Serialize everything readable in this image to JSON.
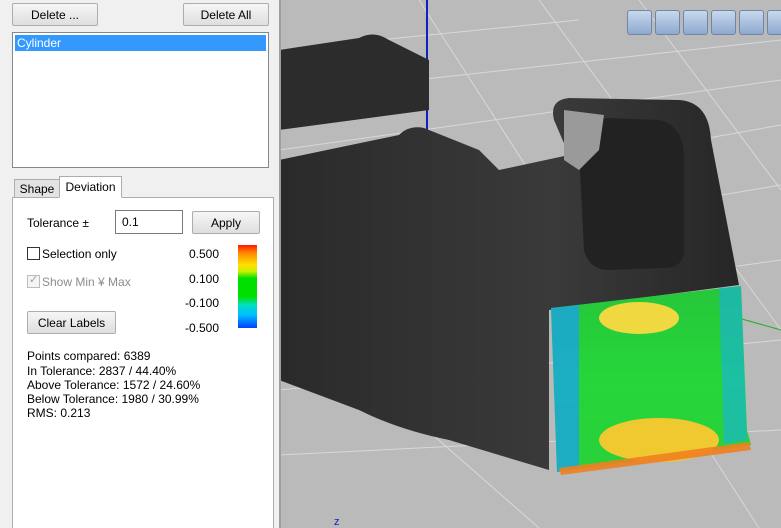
{
  "toolbar": {
    "delete_label": "Delete ...",
    "delete_all_label": "Delete All"
  },
  "objects": {
    "items": [
      "Cylinder"
    ],
    "selected": 0
  },
  "tabs": [
    {
      "label": "Shape",
      "active": false
    },
    {
      "label": "Deviation",
      "active": true
    }
  ],
  "deviation": {
    "tolerance_label": "Tolerance ±",
    "tolerance_value": "0.1",
    "apply_label": "Apply",
    "selection_only_label": "Selection only",
    "selection_only_checked": false,
    "show_minmax_label": "Show Min ¥ Max",
    "show_minmax_checked": true,
    "show_minmax_enabled": false,
    "clear_labels_label": "Clear Labels",
    "scale": {
      "labels": [
        "0.500",
        "0.100",
        "-0.100",
        "-0.500"
      ],
      "colors": [
        "#ff1a00",
        "#ff8c00",
        "#ffe000",
        "#00e000",
        "#00c0ff",
        "#0040ff"
      ]
    },
    "stats": {
      "points": "Points compared: 6389",
      "in_tol": "In Tolerance: 2837 / 44.40%",
      "above_tol": "Above Tolerance: 1572 / 24.60%",
      "below_tol": "Below Tolerance: 1980 / 30.99%",
      "rms": "RMS: 0.213"
    }
  },
  "viewport": {
    "background": "#bababa",
    "tools": [
      "zoom-fit-icon",
      "zoom-icon",
      "rotate-icon",
      "pan-icon",
      "zoom-plus-icon",
      "more-icon"
    ],
    "axis_label": "z"
  }
}
